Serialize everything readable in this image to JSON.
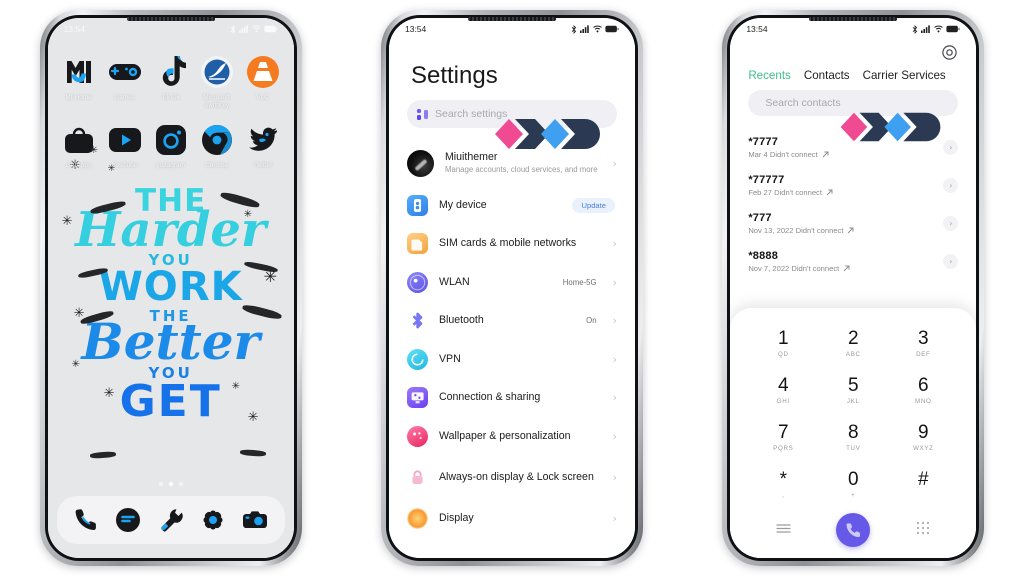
{
  "scene": {
    "background": "#ffffff",
    "device_count": 3
  },
  "phone_home": {
    "statusbar": {
      "time": "13:54",
      "icons": [
        "bluetooth-icon",
        "signal-icon",
        "wifi-icon",
        "battery-icon"
      ]
    },
    "wallpaper": {
      "lines": [
        "THE",
        "Harder",
        "YOU",
        "WORK",
        "THE",
        "Better",
        "YOU",
        "GET"
      ],
      "colors": [
        "#3ad3e0",
        "#35cfdf",
        "#26b8e0",
        "#1ba6e8",
        "#1e97e6",
        "#1b8ae8",
        "#1a7fe6",
        "#1572e8"
      ]
    },
    "apps_row1": [
      {
        "label": "MI Home",
        "icon": "mi-home-icon"
      },
      {
        "label": "Games",
        "icon": "gamepad-icon"
      },
      {
        "label": "TikTok",
        "icon": "tiktok-icon"
      },
      {
        "label": "Microsoft SwiftKey",
        "icon": "swiftkey-icon"
      },
      {
        "label": "VLC",
        "icon": "vlc-cone-icon"
      }
    ],
    "apps_row2": [
      {
        "label": "GetApps",
        "icon": "getapps-bag-icon"
      },
      {
        "label": "YouTube",
        "icon": "youtube-icon"
      },
      {
        "label": "Instagram",
        "icon": "instagram-icon"
      },
      {
        "label": "Chrome",
        "icon": "chrome-icon"
      },
      {
        "label": "Twitter",
        "icon": "twitter-bird-icon"
      }
    ],
    "page_dots": {
      "count": 3,
      "active_index": 1
    },
    "dock": [
      {
        "label": "Phone",
        "icon": "phone-handset-icon"
      },
      {
        "label": "Messages",
        "icon": "message-bubble-icon"
      },
      {
        "label": "Tools",
        "icon": "wrench-icon"
      },
      {
        "label": "Settings",
        "icon": "gear-icon"
      },
      {
        "label": "Camera",
        "icon": "camera-icon"
      }
    ]
  },
  "phone_settings": {
    "statusbar": {
      "time": "13:54",
      "icons": [
        "bluetooth-icon",
        "signal-icon",
        "wifi-icon",
        "battery-icon"
      ]
    },
    "title": "Settings",
    "search": {
      "placeholder": "Search settings",
      "icon": "search-squares-icon"
    },
    "account": {
      "name": "Miuithemer",
      "subtitle": "Manage accounts, cloud services, and more",
      "avatar": "user-avatar"
    },
    "items": [
      {
        "label": "My device",
        "value": "Update",
        "value_type": "badge",
        "icon": "device-icon",
        "color": "#3f9bf5"
      },
      {
        "label": "SIM cards & mobile networks",
        "value": "",
        "value_type": "chevron",
        "icon": "sim-card-icon",
        "color": "#f5a33f"
      },
      {
        "label": "WLAN",
        "value": "Home-5G",
        "value_type": "text",
        "icon": "wifi-globe-icon",
        "color": "#6e6cf0"
      },
      {
        "label": "Bluetooth",
        "value": "On",
        "value_type": "text",
        "icon": "bluetooth-icon",
        "color": "#5b6df0"
      },
      {
        "label": "VPN",
        "value": "",
        "value_type": "chevron",
        "icon": "vpn-icon",
        "color": "#3fc9e8"
      },
      {
        "label": "Connection & sharing",
        "value": "",
        "value_type": "chevron",
        "icon": "connection-icon",
        "color": "#7a5cf0"
      },
      {
        "label": "Wallpaper & personalization",
        "value": "",
        "value_type": "chevron",
        "icon": "palette-icon",
        "color": "#f0467e"
      },
      {
        "label": "Always-on display & Lock screen",
        "value": "",
        "value_type": "chevron",
        "icon": "lock-icon",
        "color": "#f59ac0"
      },
      {
        "label": "Display",
        "value": "",
        "value_type": "chevron",
        "icon": "brightness-icon",
        "color": "#f79a30"
      }
    ]
  },
  "phone_dialer": {
    "statusbar": {
      "time": "13:54",
      "icons": [
        "bluetooth-icon",
        "signal-icon",
        "wifi-icon",
        "battery-icon"
      ]
    },
    "settings_icon": "gear-icon",
    "tabs": [
      {
        "label": "Recents",
        "active": true
      },
      {
        "label": "Contacts",
        "active": false
      },
      {
        "label": "Carrier Services",
        "active": false
      }
    ],
    "active_tab_color": "#3fc08a",
    "search": {
      "placeholder": "Search contacts",
      "icon": "search-squares-icon"
    },
    "calls": [
      {
        "number": "*7777",
        "meta": "Mar 4 Didn't connect",
        "icon": "outgoing-call-icon"
      },
      {
        "number": "*77777",
        "meta": "Feb 27 Didn't connect",
        "icon": "outgoing-call-icon"
      },
      {
        "number": "*777",
        "meta": "Nov 13, 2022 Didn't connect",
        "icon": "outgoing-call-icon"
      },
      {
        "number": "*8888",
        "meta": "Nov 7, 2022 Didn't connect",
        "icon": "outgoing-call-icon"
      }
    ],
    "keypad": [
      {
        "digit": "1",
        "sub": "QD"
      },
      {
        "digit": "2",
        "sub": "ABC"
      },
      {
        "digit": "3",
        "sub": "DEF"
      },
      {
        "digit": "4",
        "sub": "GHI"
      },
      {
        "digit": "5",
        "sub": "JKL"
      },
      {
        "digit": "6",
        "sub": "MNO"
      },
      {
        "digit": "7",
        "sub": "PQRS"
      },
      {
        "digit": "8",
        "sub": "TUV"
      },
      {
        "digit": "9",
        "sub": "WXYZ"
      },
      {
        "digit": "*",
        "sub": ","
      },
      {
        "digit": "0",
        "sub": "+"
      },
      {
        "digit": "#",
        "sub": ""
      }
    ],
    "actions": {
      "left_icon": "menu-lines-icon",
      "call_icon": "phone-handset-icon",
      "right_icon": "keypad-grid-icon",
      "call_button_color": "#6759e8"
    }
  },
  "watermark": {
    "name": "mwd-logo",
    "colors": {
      "pink": "#ef4a92",
      "navy": "#2b3a52",
      "blue": "#3f9ff0"
    }
  }
}
